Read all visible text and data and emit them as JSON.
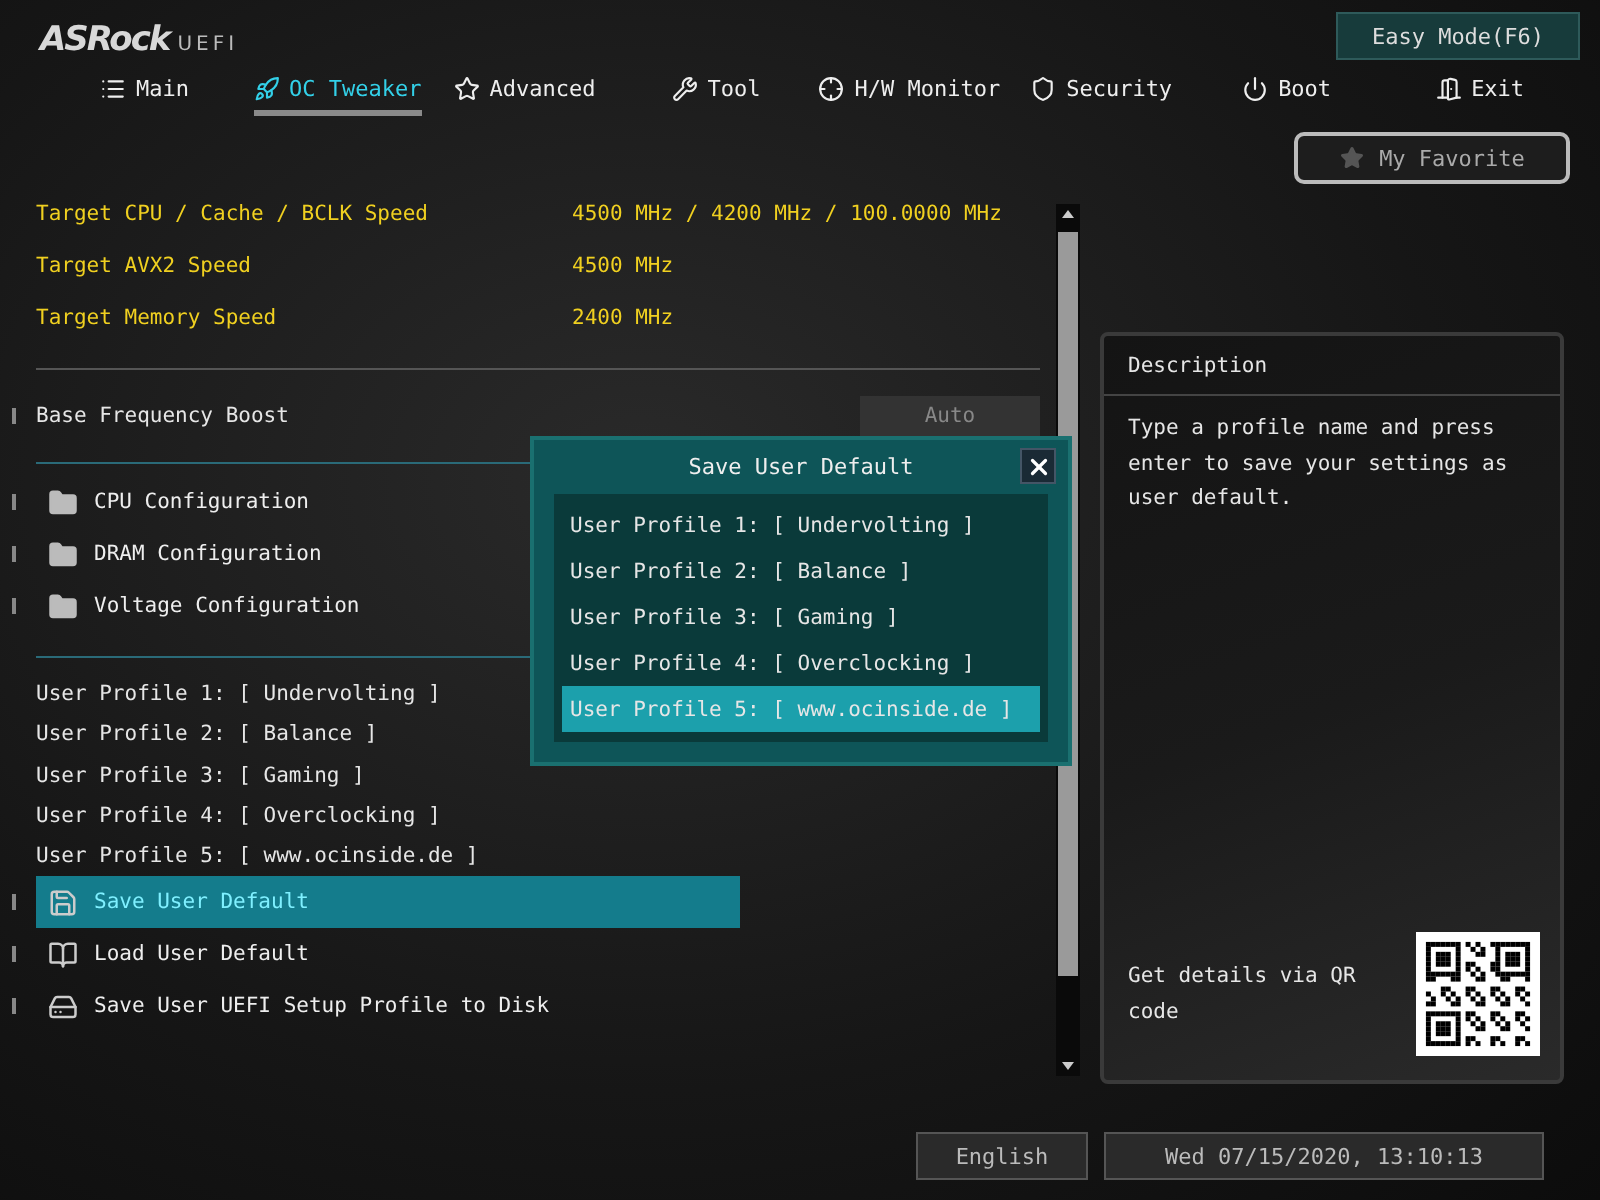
{
  "logo": {
    "brand": "ASRock",
    "suffix": "UEFI"
  },
  "mode_button": "Easy Mode(F6)",
  "tabs": [
    {
      "label": "Main",
      "selected": false
    },
    {
      "label": "OC Tweaker",
      "selected": true
    },
    {
      "label": "Advanced",
      "selected": false
    },
    {
      "label": "Tool",
      "selected": false
    },
    {
      "label": "H/W Monitor",
      "selected": false
    },
    {
      "label": "Security",
      "selected": false
    },
    {
      "label": "Boot",
      "selected": false
    },
    {
      "label": "Exit",
      "selected": false
    }
  ],
  "favorite_button": "My Favorite",
  "targets": [
    {
      "label": "Target CPU / Cache / BCLK Speed",
      "value": "4500 MHz / 4200 MHz / 100.0000 MHz"
    },
    {
      "label": "Target AVX2 Speed",
      "value": "4500 MHz"
    },
    {
      "label": "Target Memory Speed",
      "value": "2400 MHz"
    }
  ],
  "settings": [
    {
      "label": "Base Frequency Boost",
      "value": "Auto"
    }
  ],
  "folders": [
    "CPU Configuration",
    "DRAM Configuration",
    "Voltage Configuration"
  ],
  "profiles": [
    "User Profile 1: [ Undervolting ]",
    "User Profile 2: [ Balance ]",
    "User Profile 3: [ Gaming ]",
    "User Profile 4: [ Overclocking ]",
    "User Profile 5: [ www.ocinside.de ]"
  ],
  "actions": [
    {
      "label": "Save User Default",
      "selected": true
    },
    {
      "label": "Load User Default",
      "selected": false
    },
    {
      "label": "Save User UEFI Setup Profile to Disk",
      "selected": false
    }
  ],
  "dialog": {
    "title": "Save User Default",
    "items": [
      {
        "label": "User Profile 1: [ Undervolting ]",
        "selected": false
      },
      {
        "label": "User Profile 2: [ Balance ]",
        "selected": false
      },
      {
        "label": "User Profile 3: [ Gaming ]",
        "selected": false
      },
      {
        "label": "User Profile 4: [ Overclocking ]",
        "selected": false
      },
      {
        "label": "User Profile 5: [ www.ocinside.de ]",
        "selected": true
      }
    ]
  },
  "description": {
    "title": "Description",
    "text": "Type a profile name and press enter to save your settings as user default.",
    "qr_hint": "Get details via QR code"
  },
  "status_bar": {
    "language": "English",
    "datetime": "Wed 07/15/2020, 13:10:13"
  }
}
